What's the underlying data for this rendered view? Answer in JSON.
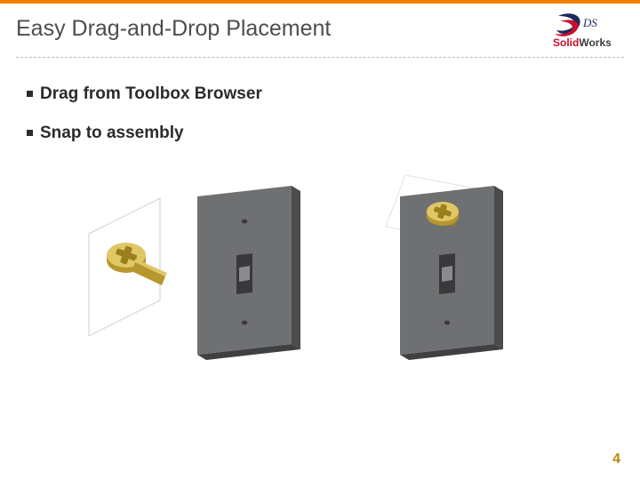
{
  "header": {
    "title": "Easy Drag-and-Drop Placement",
    "logo": {
      "brand_solid": "Solid",
      "brand_works": "Works",
      "ds_text": "DS",
      "accent_color": "#c8102e",
      "text_color": "#3b3b3b"
    }
  },
  "bullets": [
    {
      "text": "Drag from Toolbox Browser"
    },
    {
      "text": "Snap to assembly"
    }
  ],
  "illustration": {
    "plate_color": "#6f7072",
    "plate_shadow": "#4a4b4d",
    "fastener_color": "#c8a93e",
    "fastener_highlight": "#e0c766",
    "sketch_color": "#d9d9d9"
  },
  "footer": {
    "page_number": "4"
  }
}
